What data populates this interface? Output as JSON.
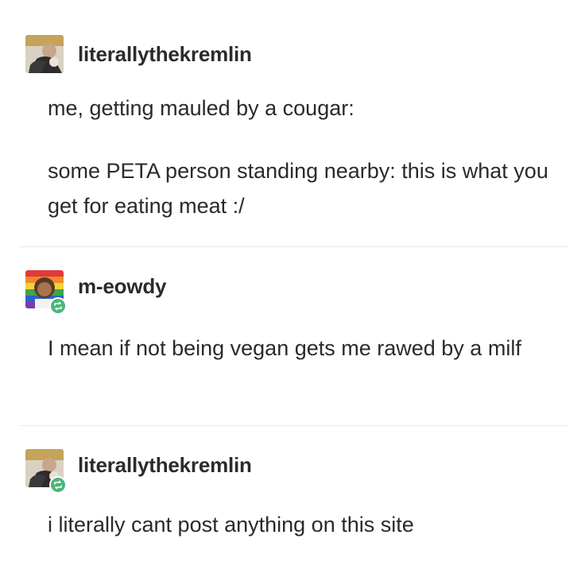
{
  "posts": [
    {
      "username": "literallythekremlin",
      "avatar": "kremlin-avatar",
      "reblog": false,
      "paragraphs": [
        "me, getting mauled by a cougar:",
        "some PETA person standing nearby: this is what you get for eating meat :/"
      ]
    },
    {
      "username": "m-eowdy",
      "avatar": "meowdy-avatar",
      "reblog": true,
      "paragraphs": [
        "I mean if not being vegan gets me rawed by a milf"
      ]
    },
    {
      "username": "literallythekremlin",
      "avatar": "kremlin-avatar",
      "reblog": true,
      "paragraphs": [
        "i literally cant post anything on this site"
      ]
    }
  ],
  "colors": {
    "text": "#2a2a2a",
    "divider": "#e9e9e9",
    "reblog_badge": "#4bb678"
  }
}
